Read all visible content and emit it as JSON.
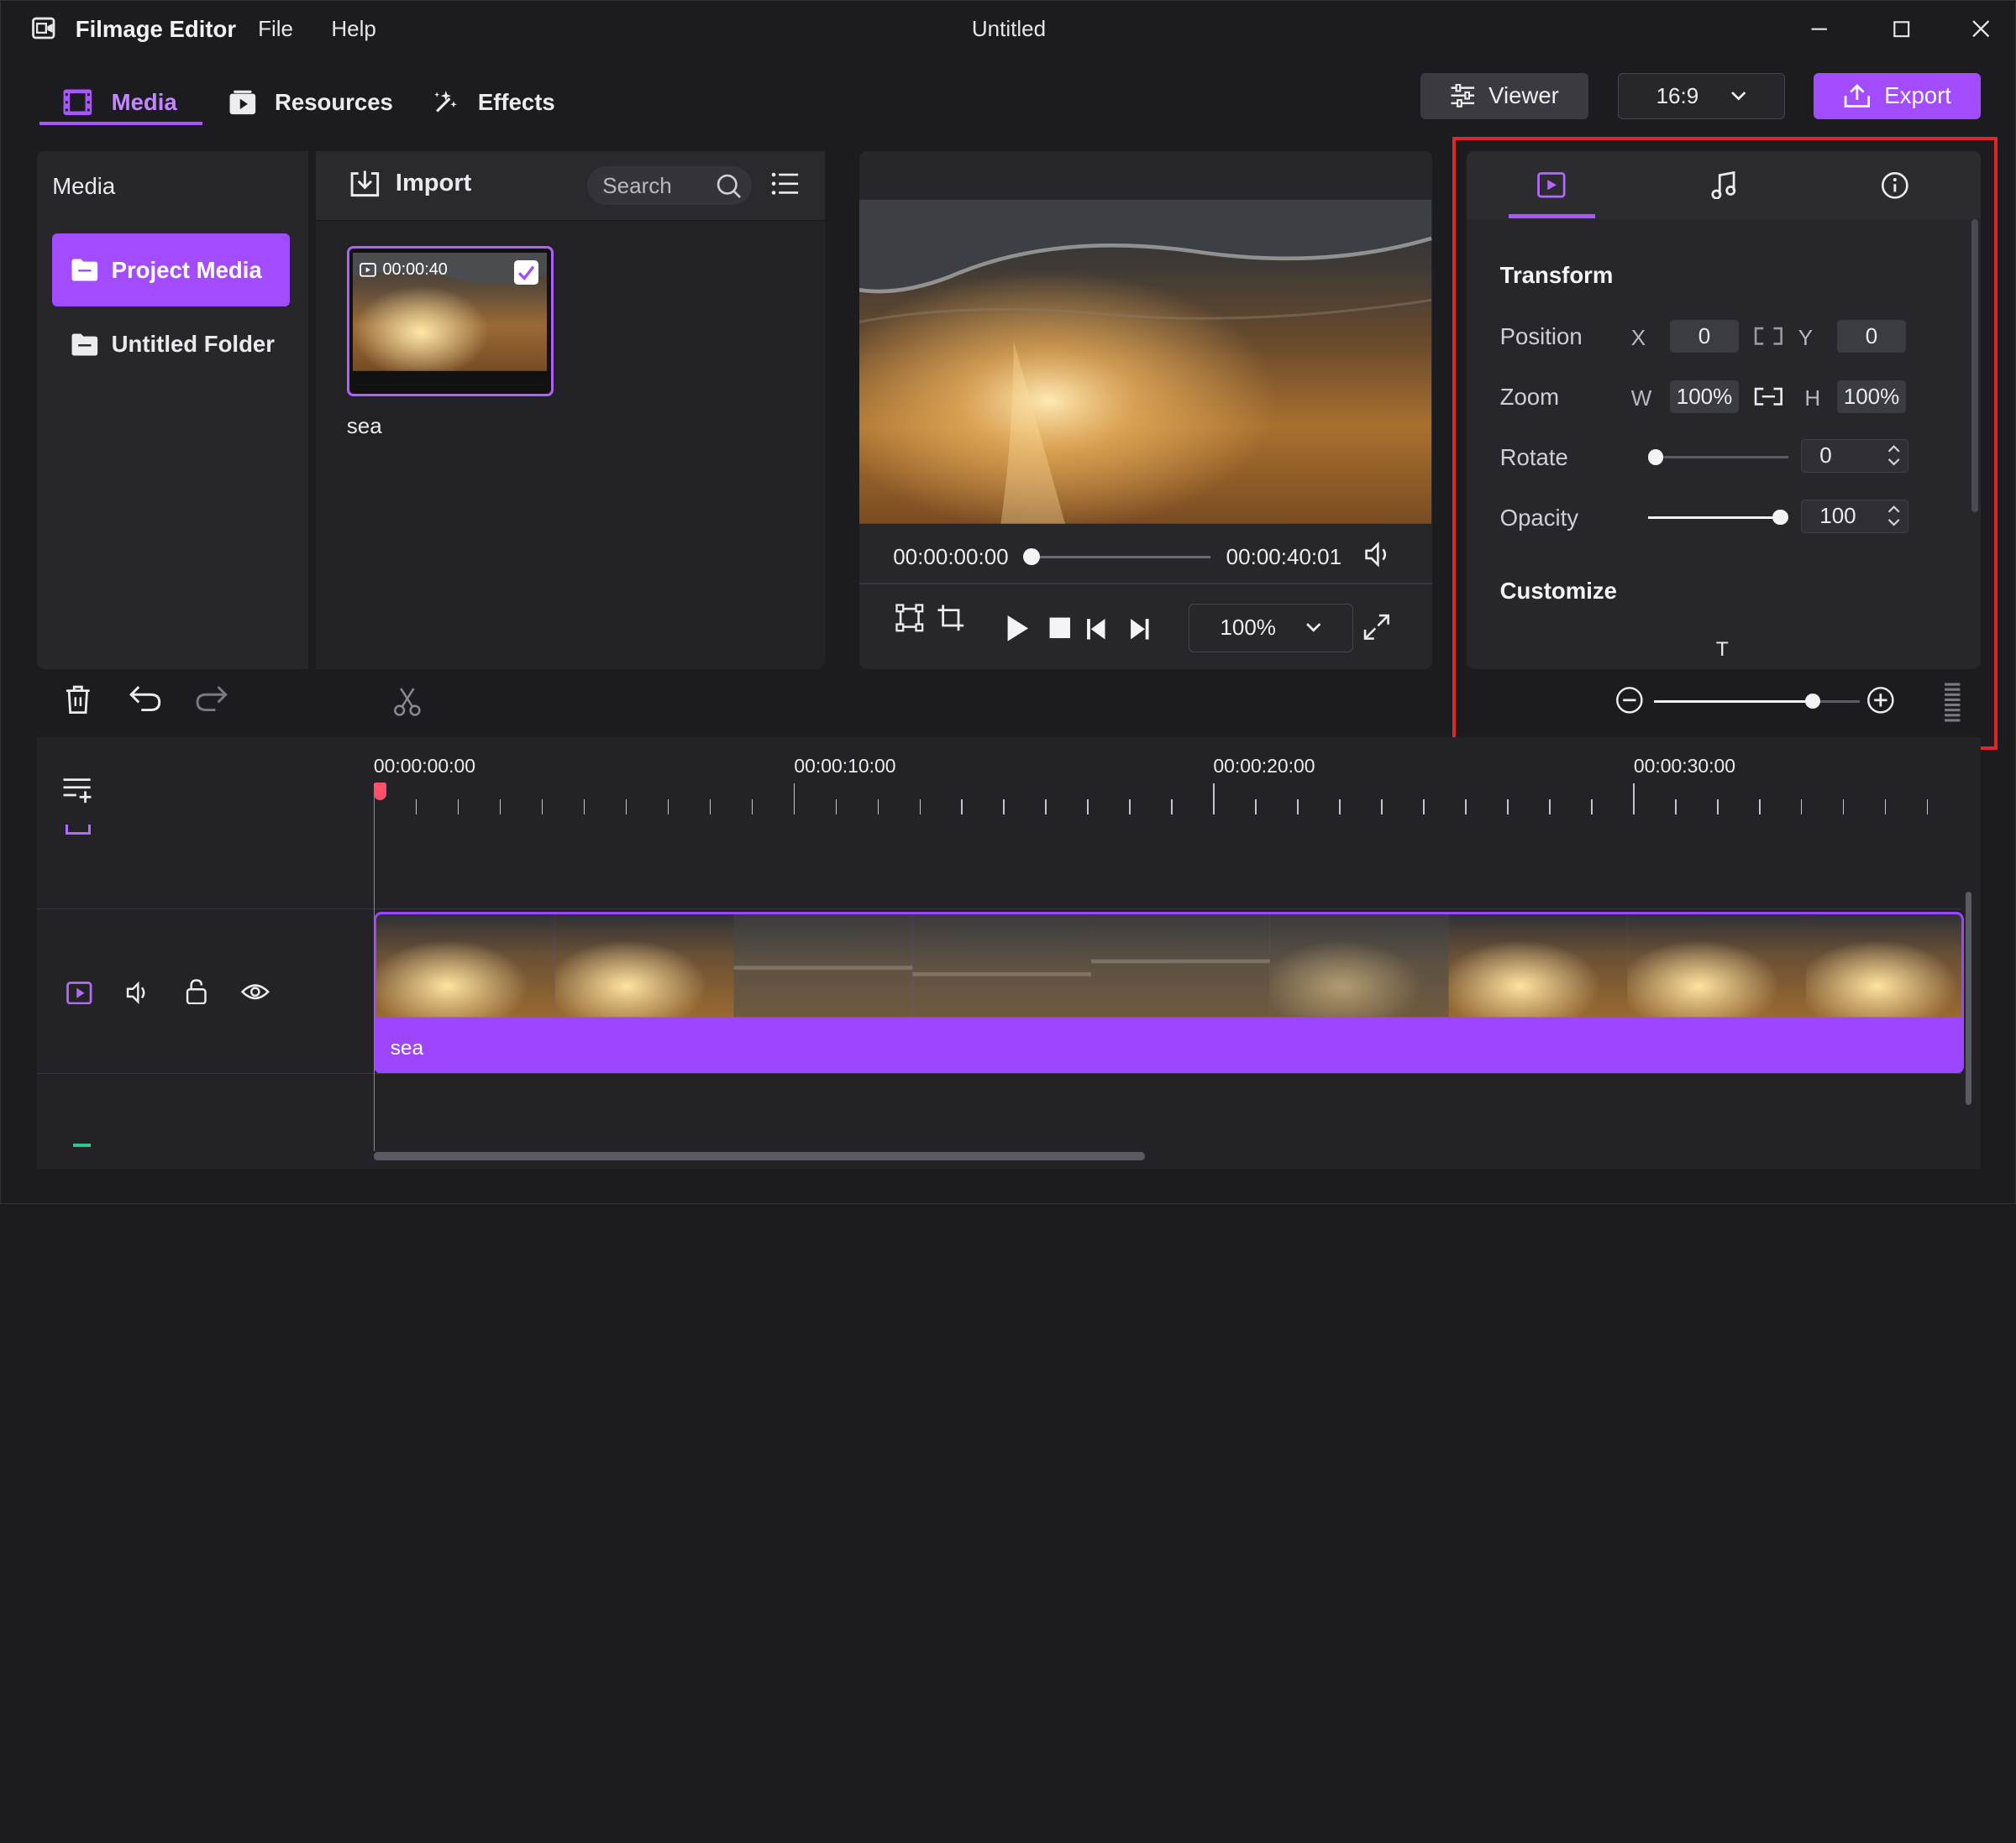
{
  "app": {
    "name": "Filmage Editor",
    "window_title": "Untitled",
    "menu": [
      "File",
      "Help"
    ],
    "icon": "film-app-icon"
  },
  "top_tabs": [
    {
      "label": "Media",
      "icon": "film-strip-icon",
      "active": true
    },
    {
      "label": "Resources",
      "icon": "resources-icon",
      "active": false
    },
    {
      "label": "Effects",
      "icon": "sparkle-icon",
      "active": false
    }
  ],
  "header": {
    "viewer_label": "Viewer",
    "ratio_value": "16:9",
    "export_label": "Export"
  },
  "media": {
    "title": "Media",
    "folders": [
      {
        "label": "Project Media",
        "active": true
      },
      {
        "label": "Untitled Folder",
        "active": false
      }
    ],
    "import_label": "Import",
    "search_placeholder": "Search",
    "items": [
      {
        "name": "sea",
        "duration": "00:00:40",
        "selected": true
      }
    ]
  },
  "viewer": {
    "current_time": "00:00:00:00",
    "total_time": "00:00:40:01",
    "zoom": "100%",
    "progress": 0
  },
  "properties": {
    "tabs": [
      "video-tab-icon",
      "music-note-icon",
      "info-icon"
    ],
    "transform_title": "Transform",
    "position": {
      "label": "Position",
      "x_label": "X",
      "x": "0",
      "y_label": "Y",
      "y": "0"
    },
    "zoom": {
      "label": "Zoom",
      "w_label": "W",
      "w": "100%",
      "h_label": "H",
      "h": "100%"
    },
    "rotate": {
      "label": "Rotate",
      "value": "0",
      "slider": 0
    },
    "opacity": {
      "label": "Opacity",
      "value": "100",
      "slider": 1
    },
    "customize_title": "Customize",
    "customize_glyph": "T",
    "timeline_zoom": 0.77
  },
  "timeline": {
    "ruler": [
      "00:00:00:00",
      "00:00:10:00",
      "00:00:20:00",
      "00:00:30:00"
    ],
    "clip_name": "sea"
  },
  "colors": {
    "accent": "#a34cff",
    "highlight_box": "#e2252b",
    "playhead": "#ff4f6a"
  }
}
